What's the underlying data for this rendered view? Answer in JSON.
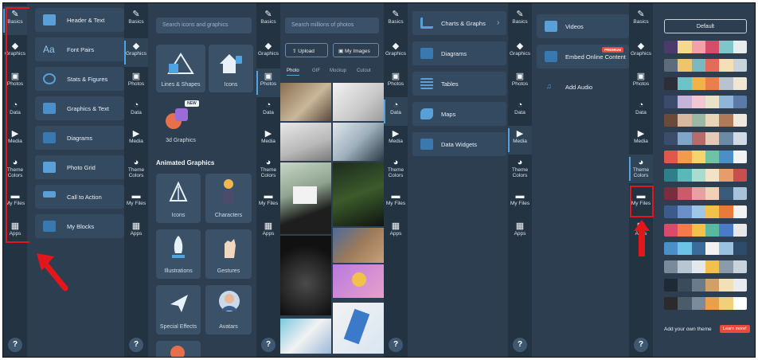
{
  "rail": {
    "items": [
      {
        "label": "Basics",
        "icon": "basics-icon",
        "glyph": "✎"
      },
      {
        "label": "Graphics",
        "icon": "graphics-icon",
        "glyph": "◆"
      },
      {
        "label": "Photos",
        "icon": "photos-icon",
        "glyph": "▣"
      },
      {
        "label": "Data",
        "icon": "data-icon",
        "glyph": "◔"
      },
      {
        "label": "Media",
        "icon": "media-icon",
        "glyph": "▶"
      },
      {
        "label": "Theme Colors",
        "icon": "palette-icon",
        "glyph": "◕"
      },
      {
        "label": "My Files",
        "icon": "folder-icon",
        "glyph": "▬"
      },
      {
        "label": "Apps",
        "icon": "apps-icon",
        "glyph": "▦"
      }
    ],
    "help_label": "?"
  },
  "basics_panel": {
    "items": [
      "Header & Text",
      "Font Pairs",
      "Stats & Figures",
      "Graphics & Text",
      "Diagrams",
      "Photo Grid",
      "Call to Action",
      "My Blocks"
    ],
    "font_pairs_glyph": "Aa"
  },
  "graphics_panel": {
    "search_placeholder": "Search icons and graphics",
    "tiles_top": [
      "Lines & Shapes",
      "Icons"
    ],
    "new_badge": "NEW",
    "tile_3d": "3d Graphics",
    "section_title": "Animated Graphics",
    "animated": [
      "Icons",
      "Characters",
      "Illustrations",
      "Gestures",
      "Special Effects",
      "Avatars"
    ]
  },
  "photos_panel": {
    "search_placeholder": "Search millions of photos",
    "upload_label": "Upload",
    "my_images_label": "My Images",
    "tabs": [
      "Photo",
      "GIF",
      "Mockup",
      "Cutout"
    ]
  },
  "data_panel": {
    "items": [
      "Charts & Graphs",
      "Diagrams",
      "Tables",
      "Maps",
      "Data Widgets"
    ]
  },
  "media_panel": {
    "items": [
      "Videos",
      "Embed Online Content",
      "Add Audio"
    ],
    "premium_badge": "PREMIUM"
  },
  "theme_panel": {
    "default_label": "Default",
    "add_theme_label": "Add your own theme",
    "learn_more_label": "Learn more!",
    "palettes": [
      [
        "#4b3b6b",
        "#f6d98b",
        "#f3a0a8",
        "#d44d6a",
        "#7fc6c9",
        "#e9ecef"
      ],
      [
        "#5d6b7a",
        "#f0c36d",
        "#7cb8c0",
        "#e46a5c",
        "#f3e0b6",
        "#c9d3dc"
      ],
      [
        "#2e2e38",
        "#6cc3c8",
        "#f1b24a",
        "#e97f4b",
        "#b9c3ce",
        "#f0e6d2"
      ],
      [
        "#3b4b6b",
        "#c6b3d9",
        "#f2c7d1",
        "#e8e2c8",
        "#8fb6d9",
        "#5b7aa8"
      ],
      [
        "#6b4a3a",
        "#d8b9a0",
        "#9bb7a6",
        "#e7d7b8",
        "#b07a5a",
        "#f0e8dd"
      ],
      [
        "#3a4e6b",
        "#7fa6c9",
        "#b76b6b",
        "#e3c9b8",
        "#6b8aa8",
        "#d0dbe6"
      ],
      [
        "#e1574b",
        "#f29c4b",
        "#f6d46b",
        "#6fc2a6",
        "#4b8fc9",
        "#f2f2f2"
      ],
      [
        "#2d7f8a",
        "#59b8b8",
        "#a8dcd1",
        "#f2e3c6",
        "#e89b6b",
        "#c94f4f"
      ],
      [
        "#7b2d3d",
        "#c95b6b",
        "#e8a0a0",
        "#f2d0b8",
        "#3b5b7a",
        "#a8c3d9"
      ],
      [
        "#3b5b8a",
        "#6b8fc9",
        "#9fc6e6",
        "#f2c14b",
        "#e87a3b",
        "#f2f2f2"
      ],
      [
        "#d94b6b",
        "#f27a4b",
        "#f2c14b",
        "#5bb8a0",
        "#4b7ac9",
        "#e8e8e8"
      ],
      [
        "#4b8fc9",
        "#6bc3e6",
        "#3b6b9b",
        "#f2f2f2",
        "#9bc3e0",
        "#2d4b6b"
      ],
      [
        "#7a8a9b",
        "#b8c6d3",
        "#e3e8ed",
        "#f2c14b",
        "#8a9bab",
        "#c9d3dc"
      ],
      [
        "#1e2a36",
        "#3b4b5b",
        "#6b7b8b",
        "#d0a06b",
        "#f2e0b8",
        "#e8ecef"
      ],
      [
        "#2b2b2b",
        "#4b5b6b",
        "#7b8b9b",
        "#e8a04b",
        "#f2d07a",
        "#ffffff"
      ]
    ]
  }
}
